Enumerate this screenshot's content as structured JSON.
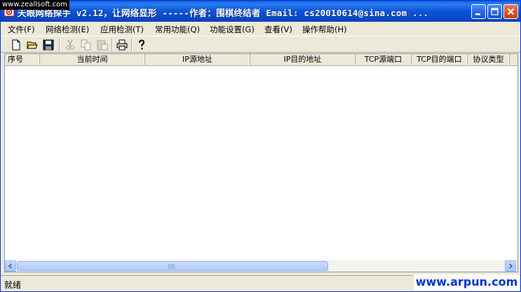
{
  "window": {
    "title": "天眼网络探手 v2.12，让网络显形 -----作者：围棋终结者 Email: cs20010614@sina.com ...",
    "title_bar_color": "#0a55d6"
  },
  "watermarks": {
    "top": "www.zeallsoft.com",
    "bottom": "www.arpun.com"
  },
  "menu": {
    "items": [
      {
        "label": "文件(F)"
      },
      {
        "label": "网络检测(E)"
      },
      {
        "label": "应用检测(T)"
      },
      {
        "label": "常用功能(Q)"
      },
      {
        "label": "功能设置(G)"
      },
      {
        "label": "查看(V)"
      },
      {
        "label": "操作帮助(H)"
      }
    ]
  },
  "toolbar": {
    "buttons": [
      {
        "icon": "new-file-icon",
        "enabled": true
      },
      {
        "icon": "open-folder-icon",
        "enabled": true
      },
      {
        "icon": "save-icon",
        "enabled": true
      },
      {
        "icon": "cut-icon",
        "enabled": false
      },
      {
        "icon": "copy-icon",
        "enabled": false
      },
      {
        "icon": "paste-icon",
        "enabled": false
      },
      {
        "icon": "print-icon",
        "enabled": true
      },
      {
        "icon": "help-icon",
        "enabled": true
      }
    ]
  },
  "table": {
    "columns": [
      "序号",
      "当前时间",
      "IP源地址",
      "IP目的地址",
      "TCP源端口",
      "TCP目的端口",
      "协议类型"
    ],
    "rows": []
  },
  "status": {
    "text": "就绪"
  }
}
